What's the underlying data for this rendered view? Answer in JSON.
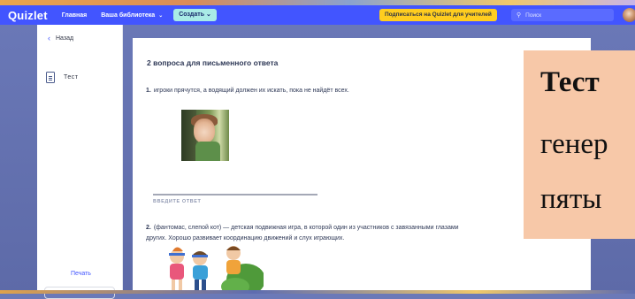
{
  "navbar": {
    "logo": "Quizlet",
    "home": "Главная",
    "library": "Ваша библиотека",
    "create": "Создать",
    "subscribe": "Подписаться на Quizlet для учителей",
    "search_placeholder": "Поиск"
  },
  "sidebar": {
    "back": "Назад",
    "item": "Тест",
    "print": "Печать"
  },
  "test": {
    "heading": "2 вопроса для письменного ответа",
    "q1_number": "1.",
    "q1_text": "игроки прячутся, а водящий должен их искать, пока не найдёт всех.",
    "answer_label": "ВВЕДИТЕ ОТВЕТ",
    "q2_number": "2.",
    "q2_text_line1": "(фантомас, слепой кот) — детская подвижная игра, в которой один из участников с завязанными глазами",
    "q2_text_line2": "других. Хорошо развивает координацию движений и слух играющих."
  },
  "overlay": {
    "line1": "Тест",
    "line2": "генер",
    "line3": "пяты"
  },
  "colors": {
    "brand_blue": "#4255ff",
    "create_mint": "#a9ebe6",
    "subscribe_yellow": "#ffcd1f",
    "overlay_peach": "#f7c8a8"
  },
  "icons": [
    "chevron-down-icon",
    "search-icon",
    "chevron-left-icon",
    "document-icon"
  ]
}
